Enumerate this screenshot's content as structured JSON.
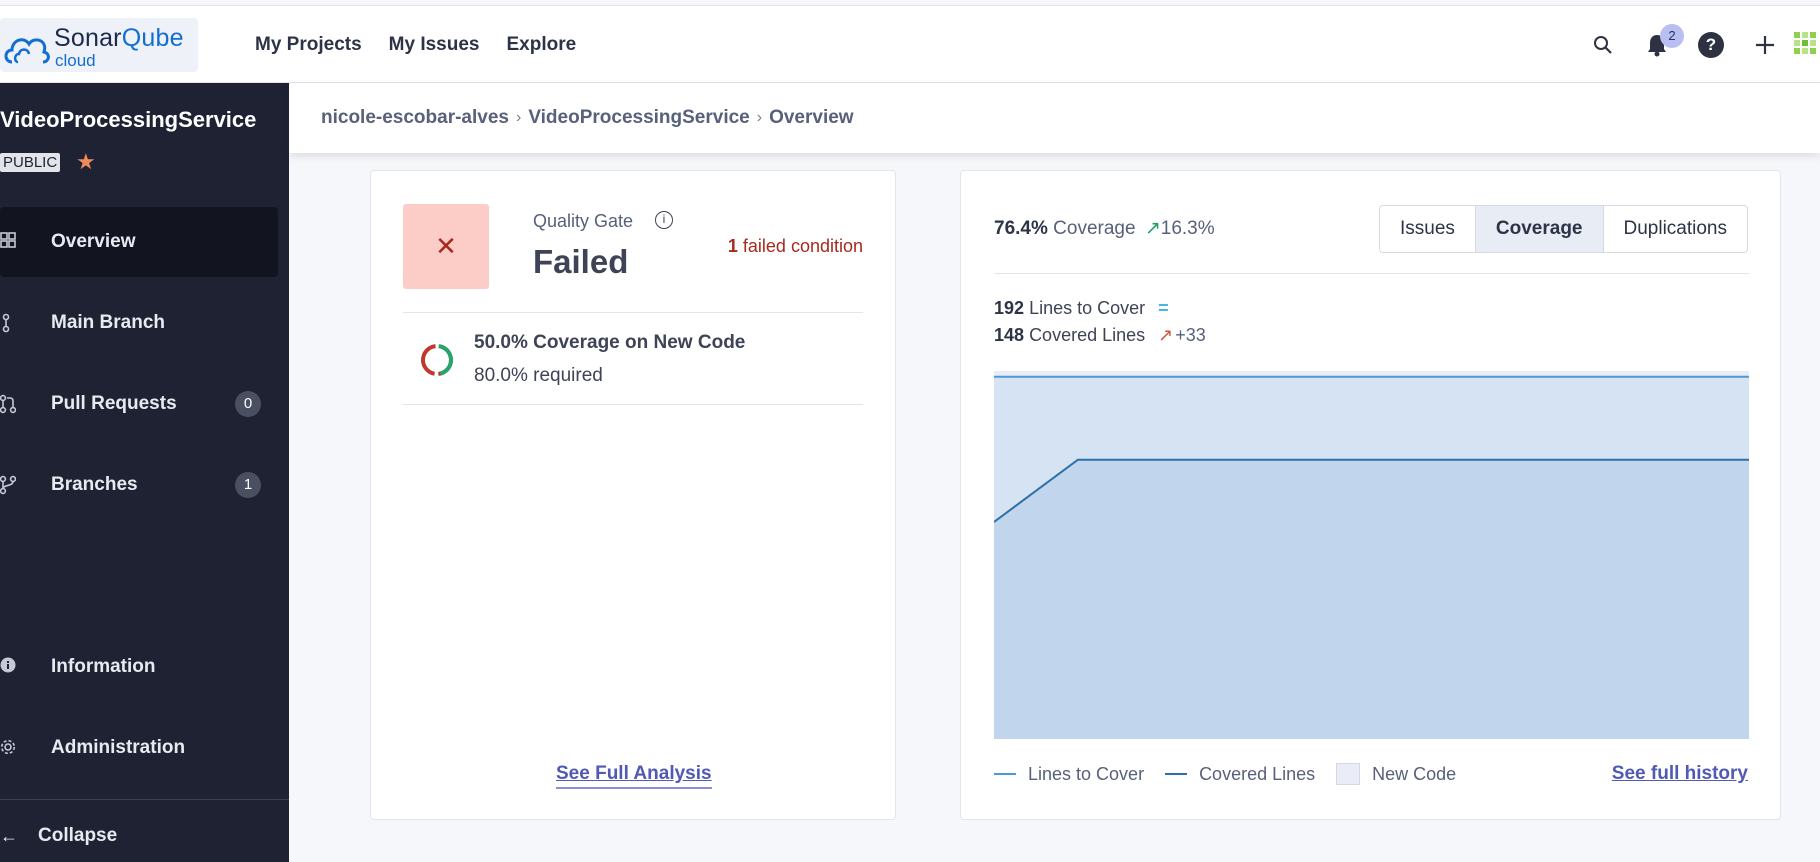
{
  "header": {
    "logo": {
      "brand_a": "Sonar",
      "brand_b": "Qube",
      "sub": "cloud"
    },
    "nav": [
      "My Projects",
      "My Issues",
      "Explore"
    ],
    "notifications_count": "2",
    "help_symbol": "?",
    "icons": [
      "search-icon",
      "bell-icon",
      "help-icon",
      "plus-icon",
      "avatar"
    ]
  },
  "sidebar": {
    "project_name": "VideoProcessingService",
    "visibility": "PUBLIC",
    "items": [
      {
        "label": "Overview",
        "icon": "dashboard-icon",
        "active": true
      },
      {
        "label": "Main Branch",
        "icon": "branch-icon"
      },
      {
        "label": "Pull Requests",
        "icon": "pull-request-icon",
        "count": "0"
      },
      {
        "label": "Branches",
        "icon": "branches-icon",
        "count": "1"
      },
      {
        "label": "Information",
        "icon": "info-icon"
      },
      {
        "label": "Administration",
        "icon": "gear-icon"
      }
    ],
    "collapse_label": "Collapse"
  },
  "breadcrumb": [
    "nicole-escobar-alves",
    "VideoProcessingService",
    "Overview"
  ],
  "quality_gate": {
    "label": "Quality Gate",
    "status": "Failed",
    "failed_count": "1",
    "failed_text": "failed condition",
    "condition_title": "50.0% Coverage on New Code",
    "condition_required": "80.0% required",
    "condition_value_pct": 50,
    "link": "See Full Analysis",
    "colors": {
      "failed_bg": "#fcccc6",
      "failed_text": "#a72a1d"
    }
  },
  "coverage": {
    "value": "76.4%",
    "label": "Coverage",
    "delta": "16.3%",
    "tabs": [
      "Issues",
      "Coverage",
      "Duplications"
    ],
    "active_tab": "Coverage",
    "lines_to_cover": "192",
    "lines_to_cover_label": "Lines to Cover",
    "lines_to_cover_delta": "=",
    "covered_lines": "148",
    "covered_lines_label": "Covered Lines",
    "covered_lines_delta": "+33",
    "legend": [
      "Lines to Cover",
      "Covered Lines",
      "New Code"
    ],
    "history_link": "See full history"
  },
  "chart_data": {
    "type": "area",
    "x": [
      0,
      1,
      2,
      3,
      4,
      5,
      6,
      7,
      8,
      9
    ],
    "series": [
      {
        "name": "Lines to Cover",
        "values": [
          192,
          192,
          192,
          192,
          192,
          192,
          192,
          192,
          192,
          192
        ],
        "color": "#4a9ad4"
      },
      {
        "name": "Covered Lines",
        "values": [
          115,
          148,
          148,
          148,
          148,
          148,
          148,
          148,
          148,
          148
        ],
        "color": "#2d6fa8"
      }
    ],
    "ylim": [
      0,
      195
    ],
    "new_code_period": true,
    "grid": false
  }
}
